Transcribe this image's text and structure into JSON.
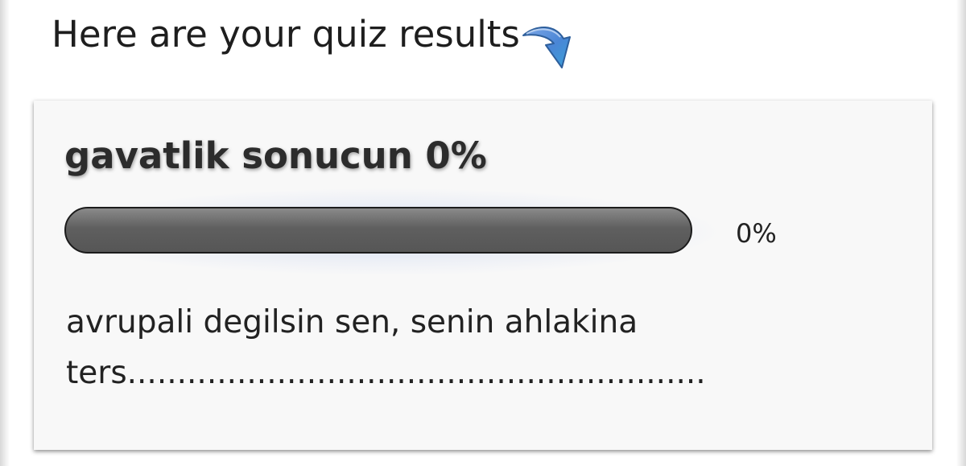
{
  "page": {
    "heading": "Here are your quiz results",
    "arrow_icon": "curved-arrow-down-icon"
  },
  "result_card": {
    "title": "gavatlik sonucun 0%",
    "progress": {
      "value_percent": 0,
      "label": "0%",
      "track_color": "#5f5f5f",
      "fill_color": "#3a7bd5"
    },
    "description_line1": "avrupali degilsin sen, senin ahlakina",
    "description_line2": "ters.........................................................."
  }
}
